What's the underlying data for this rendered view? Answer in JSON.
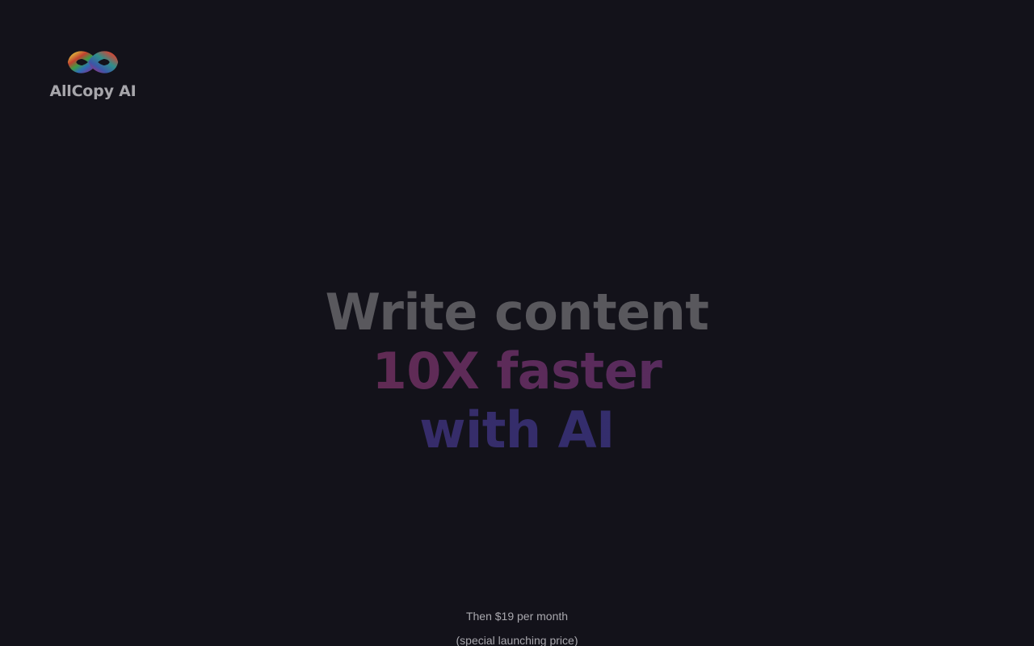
{
  "brand": {
    "name": "AllCopy AI",
    "logo_icon": "infinity-logo-icon"
  },
  "hero": {
    "line1": "Write content",
    "line2": "10X faster",
    "line3": "with AI"
  },
  "pricing": {
    "line1": "Then $19 per month",
    "line2": "(special launching price)"
  },
  "colors": {
    "background": "#13121a",
    "brand_text": "#a7a6ab",
    "headline": "#59585d",
    "gradient_start": "#6a2c44",
    "gradient_mid": "#4a2c66",
    "gradient_end": "#2e2f72",
    "price_text": "#a9a8ae"
  }
}
